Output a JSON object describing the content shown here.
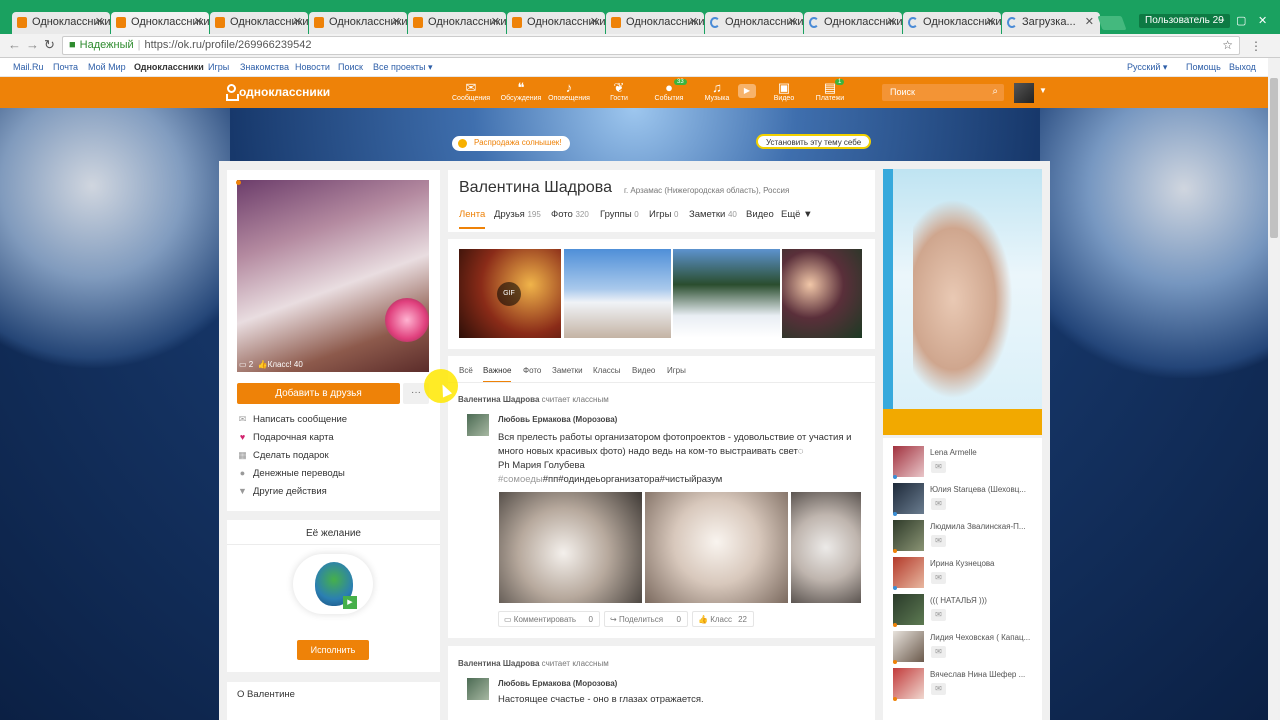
{
  "browser": {
    "tabs": [
      {
        "title": "Одноклассники"
      },
      {
        "title": "Одноклассники"
      },
      {
        "title": "Одноклассники"
      },
      {
        "title": "Одноклассники"
      },
      {
        "title": "Одноклассники"
      },
      {
        "title": "Одноклассники"
      },
      {
        "title": "Одноклассники"
      },
      {
        "title": "Одноклассники"
      },
      {
        "title": "Одноклассники"
      },
      {
        "title": "Одноклассники"
      },
      {
        "title": "Загрузка..."
      }
    ],
    "user_badge": "Пользователь 29",
    "secure_label": "Надежный",
    "url": "https://ok.ru/profile/269966239542"
  },
  "mailbar": {
    "links": [
      "Mail.Ru",
      "Почта",
      "Мой Мир",
      "Одноклассники",
      "Игры",
      "Знакомства",
      "Новости",
      "Поиск",
      "Все проекты ▾"
    ],
    "lang": "Русский ▾",
    "help": "Помощь",
    "logout": "Выход"
  },
  "toolbar": {
    "logo": "одноклассники",
    "nav": [
      {
        "label": "Сообщения",
        "icon": "envelope-icon",
        "badge": ""
      },
      {
        "label": "Обсуждения",
        "icon": "chat-icon",
        "badge": ""
      },
      {
        "label": "Оповещения",
        "icon": "bell-icon",
        "badge": ""
      },
      {
        "label": "Гости",
        "icon": "footprints-icon",
        "badge": ""
      },
      {
        "label": "События",
        "icon": "events-icon",
        "badge": "33"
      },
      {
        "label": "Музыка",
        "icon": "music-icon",
        "badge": ""
      },
      {
        "label": "Видео",
        "icon": "video-icon",
        "badge": ""
      },
      {
        "label": "Платежи",
        "icon": "payments-icon",
        "badge": "1"
      }
    ],
    "search_placeholder": "Поиск"
  },
  "banner": {
    "sale": "Распродажа солнышек!",
    "install_theme": "Установить эту тему себе"
  },
  "profile": {
    "name": "Валентина Шадрова",
    "location": "г. Арзамас (Нижегородская область), Россия",
    "avatar_comments": "2",
    "avatar_likes": "Класс! 40",
    "add_friend": "Добавить в друзья",
    "more": "···",
    "actions": [
      {
        "label": "Написать сообщение",
        "icon": "message-icon"
      },
      {
        "label": "Подарочная карта",
        "icon": "gift-card-icon"
      },
      {
        "label": "Сделать подарок",
        "icon": "gift-icon"
      },
      {
        "label": "Денежные переводы",
        "icon": "money-transfer-icon"
      },
      {
        "label": "Другие действия",
        "icon": "caret-down-icon"
      }
    ],
    "wish_title": "Её желание",
    "wish_button": "Исполнить",
    "about_title": "О Валентине",
    "tabs": [
      {
        "label": "Лента",
        "count": ""
      },
      {
        "label": "Друзья",
        "count": "195"
      },
      {
        "label": "Фото",
        "count": "320"
      },
      {
        "label": "Группы",
        "count": "0"
      },
      {
        "label": "Игры",
        "count": "0"
      },
      {
        "label": "Заметки",
        "count": "40"
      },
      {
        "label": "Видео",
        "count": ""
      },
      {
        "label": "Ещё ▼",
        "count": ""
      }
    ]
  },
  "photos": {
    "gif_label": "GIF"
  },
  "feed": {
    "filters": [
      "Всё",
      "Важное",
      "Фото",
      "Заметки",
      "Классы",
      "Видео",
      "Игры"
    ],
    "post1": {
      "liker_name": "Валентина Шадрова",
      "liker_action": "считает классным",
      "author": "Любовь Ермакова (Морозова)",
      "text_line1": "Вся прелесть работы организатором фотопроектов - удовольствие от участия и",
      "text_line2": "много новых красивых фото) надо ведь на ком-то выстраивать свет◌",
      "text_line3": "Ph Мария Голубева",
      "tags": "#сомоеды",
      "tags2": "#пп#одиндеьорганизатора#чистыйразум",
      "comment_label": "Комментировать",
      "comment_count": "0",
      "share_label": "Поделиться",
      "share_count": "0",
      "like_label": "Класс",
      "like_count": "22"
    },
    "post2": {
      "liker_name": "Валентина Шадрова",
      "liker_action": "считает классным",
      "author": "Любовь Ермакова (Морозова)",
      "text": "Настоящее счастье - оно в глазах отражается."
    }
  },
  "friends": [
    {
      "name": "Lena Armelle",
      "status": "#3a8fd6"
    },
    {
      "name": "Юлия Starцева (Шеховц...",
      "status": "#3a8fd6"
    },
    {
      "name": "Людмила Звалинская-П...",
      "status": "#ee8208"
    },
    {
      "name": "Ирина Кузнецова",
      "status": "#3a8fd6"
    },
    {
      "name": "((( НАТАЛЬЯ )))",
      "status": "#ee8208"
    },
    {
      "name": "Лидия Чеховская ( Капац...",
      "status": "#ee8208"
    },
    {
      "name": "Вячеслав Нина Шефер ...",
      "status": "#ee8208"
    }
  ],
  "colors": {
    "brand": "#ee8208",
    "browser_chrome": "#1aa160"
  }
}
